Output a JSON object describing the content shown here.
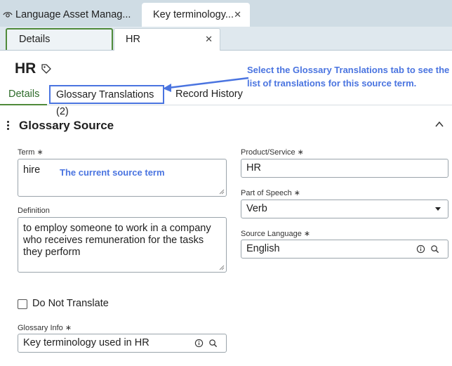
{
  "window": {
    "tabs": [
      {
        "label": "Language Asset Manag..."
      },
      {
        "label": "Key terminology..."
      }
    ]
  },
  "subtabs": {
    "details_label": "Details",
    "record_label": "HR"
  },
  "record": {
    "title": "HR"
  },
  "annotations": {
    "tab_hint": "Select the Glossary Translations tab to see the list of translations for this source term.",
    "term_hint": "The current source term"
  },
  "record_tabs": {
    "details": "Details",
    "glossary_translations": "Glossary Translations (2)",
    "record_history": "Record History"
  },
  "section": {
    "title": "Glossary Source"
  },
  "form": {
    "term": {
      "label": "Term",
      "value": "hire"
    },
    "definition": {
      "label": "Definition",
      "value": "to employ someone to work in a company who receives remuneration for the tasks they perform"
    },
    "do_not_translate": {
      "label": "Do Not Translate",
      "checked": false
    },
    "glossary_info": {
      "label": "Glossary Info",
      "value": "Key terminology used in HR"
    },
    "product_service": {
      "label": "Product/Service",
      "value": "HR"
    },
    "part_of_speech": {
      "label": "Part of Speech",
      "value": "Verb"
    },
    "source_language": {
      "label": "Source Language",
      "value": "English"
    }
  },
  "required_mark": "∗",
  "icons": {
    "app": "eye-icon",
    "close": "close-icon",
    "tag": "tag-icon",
    "info": "info-icon",
    "search": "search-icon",
    "kebab": "kebab-menu-icon",
    "collapse": "chevron-up-icon",
    "caret": "caret-down-icon"
  },
  "colors": {
    "accent_green": "#4f8a3a",
    "annotation_blue": "#4a74e0",
    "tab_strip": "#cfdce4"
  }
}
